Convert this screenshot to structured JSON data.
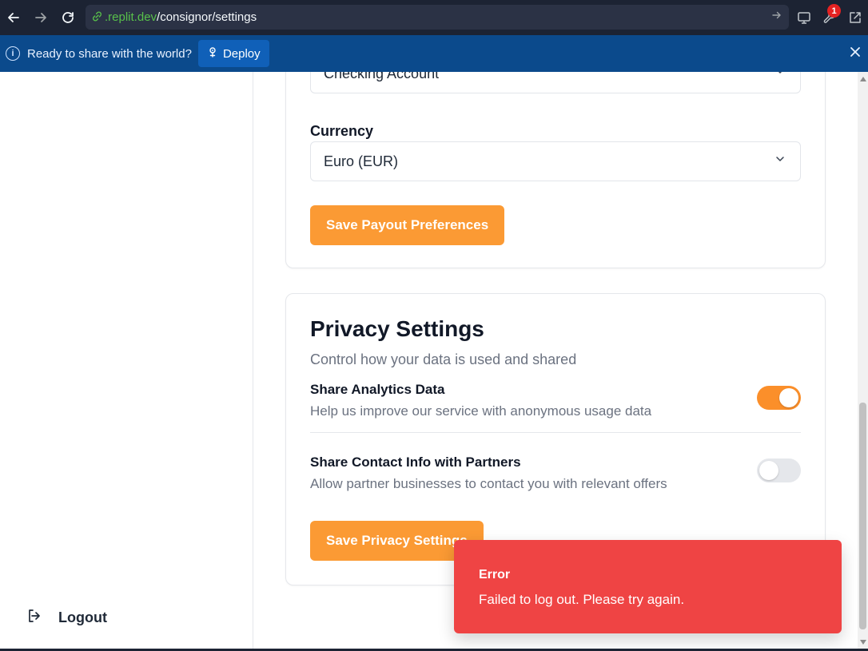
{
  "browser": {
    "url_domain": ".replit.dev",
    "url_path": "/consignor/settings",
    "notification_count": "1"
  },
  "banner": {
    "message": "Ready to share with the world?",
    "deploy_label": "Deploy"
  },
  "sidebar": {
    "logout_label": "Logout"
  },
  "payout": {
    "account_type_value": "Checking Account",
    "currency_label": "Currency",
    "currency_value": "Euro (EUR)",
    "save_label": "Save Payout Preferences"
  },
  "privacy": {
    "title": "Privacy Settings",
    "description": "Control how your data is used and shared",
    "settings": [
      {
        "title": "Share Analytics Data",
        "description": "Help us improve our service with anonymous usage data",
        "enabled": true
      },
      {
        "title": "Share Contact Info with Partners",
        "description": "Allow partner businesses to contact you with relevant offers",
        "enabled": false
      }
    ],
    "save_label": "Save Privacy Settings"
  },
  "toast": {
    "title": "Error",
    "message": "Failed to log out. Please try again.",
    "color": "#ef4444"
  },
  "colors": {
    "accent": "#fb9a34",
    "toggle_on": "#fb8f2a",
    "banner": "#0b4a8c",
    "browser_bar": "#1c2333"
  },
  "icons": [
    "back-arrow-icon",
    "forward-arrow-icon",
    "reload-icon",
    "link-icon",
    "go-arrow-icon",
    "monitor-icon",
    "wrench-icon",
    "external-link-icon",
    "info-icon",
    "deploy-icon",
    "close-icon",
    "logout-icon",
    "chevron-down-icon"
  ]
}
